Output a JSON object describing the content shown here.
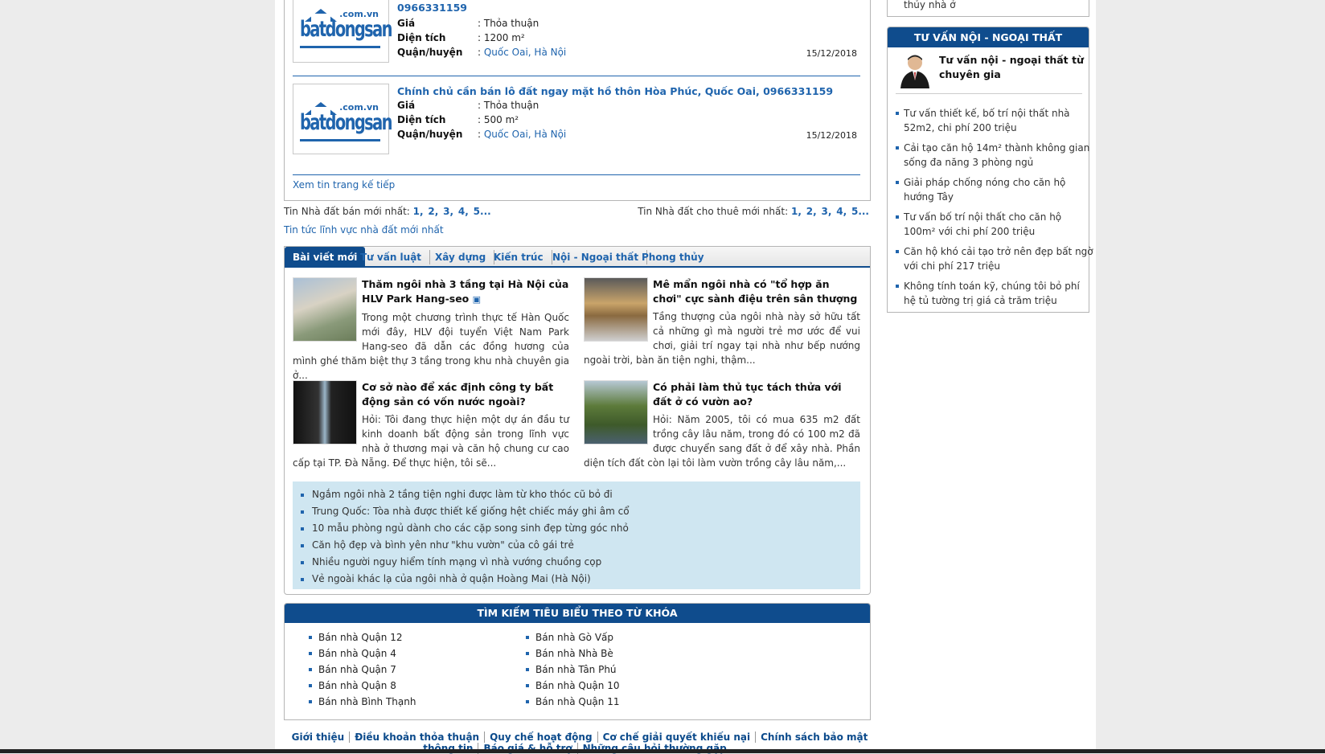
{
  "listings": [
    {
      "title_tail": "0966331159",
      "price_label": "Giá",
      "price": ": Thỏa thuận",
      "area_label": "Diện tích",
      "area": ": 1200 m²",
      "district_label": "Quận/huyện",
      "district_prefix": ": ",
      "district": "Quốc Oai, Hà Nội",
      "date": "15/12/2018"
    },
    {
      "title": "Chính chủ cần bán lô đất ngay mặt hồ thôn Hòa Phúc, Quốc Oai, 0966331159",
      "price_label": "Giá",
      "price": ": Thỏa thuận",
      "area_label": "Diện tích",
      "area": ": 500 m²",
      "district_label": "Quận/huyện",
      "district_prefix": ": ",
      "district": "Quốc Oai, Hà Nội",
      "date": "15/12/2018"
    }
  ],
  "logo": {
    "sub": ".com.vn",
    "main": "batdongsan"
  },
  "next_page_link": "Xem tin trang kế tiếp",
  "latest": {
    "sale_label": "Tin Nhà đất bán mới nhất:",
    "rent_label": "Tin Nhà đất cho thuê mới nhất:",
    "pages": [
      "1,",
      "2,",
      "3,",
      "4,",
      "5..."
    ],
    "news_link": "Tin tức lĩnh vực nhà đất mới nhất"
  },
  "tabs": [
    "Bài viết mới",
    "Tư vấn luật",
    "Xây dựng",
    "Kiến trúc",
    "Nội - Ngoại thất",
    "Phong thủy"
  ],
  "articles": [
    {
      "title": "Thăm ngôi nhà 3 tầng tại Hà Nội của HLV Park Hang-seo",
      "summary": "Trong một chương trình thực tế Hàn Quốc mới đây, HLV đội tuyển Việt Nam Park Hang-seo đã dẫn các đồng hương của mình ghé thăm biệt thự 3 tầng trong khu nhà chuyên gia ở..."
    },
    {
      "title": "Mê mẩn ngôi nhà có \"tổ hợp ăn chơi\" cực sành điệu trên sân thượng",
      "summary": "Tầng thượng của ngôi nhà này sở hữu tất cả những gì mà người trẻ mơ ước để vui chơi, giải trí ngay tại nhà như bếp nướng ngoài trời, bàn ăn tiện nghi, thậm..."
    },
    {
      "title": "Cơ sở nào để xác định công ty bất động sản có vốn nước ngoài?",
      "summary": "Hỏi: Tôi đang thực hiện một dự án đầu tư kinh doanh bất động sản trong lĩnh vực nhà ở thương mại và căn hộ chung cư cao cấp tại TP. Đà Nẵng. Để thực hiện, tôi sẽ..."
    },
    {
      "title": "Có phải làm thủ tục tách thửa với đất ở có vườn ao?",
      "summary": "Hỏi: Năm 2005, tôi có mua 635 m2 đất trồng cây lâu năm, trong đó có 100 m2 đã được chuyển sang đất ở để xây nhà. Phần diện tích đất còn lại tôi làm vườn trồng cây lâu năm,..."
    }
  ],
  "more_articles": [
    "Ngắm ngôi nhà 2 tầng tiện nghi được làm từ kho thóc cũ bỏ đi",
    "Trung Quốc: Tòa nhà được thiết kế giống hệt chiếc máy ghi âm cổ",
    "10 mẫu phòng ngủ dành cho các cặp song sinh đẹp từng góc nhỏ",
    "Căn hộ đẹp và bình yên như \"khu vườn\" của cô gái trẻ",
    "Nhiều người nguy hiểm tính mạng vì nhà vướng chuồng cọp",
    "Vẻ ngoài khác lạ của ngôi nhà ở quận Hoàng Mai (Hà Nội)"
  ],
  "keywords": {
    "title": "TÌM KIẾM TIÊU BIỂU THEO TỪ KHÓA",
    "col1": [
      "Bán nhà Quận 12",
      "Bán nhà Quận 4",
      "Bán nhà Quận 7",
      "Bán nhà Quận 8",
      "Bán nhà Bình Thạnh"
    ],
    "col2": [
      "Bán nhà Gò Vấp",
      "Bán nhà Nhà Bè",
      "Bán nhà Tân Phú",
      "Bán nhà Quận 10",
      "Bán nhà Quận 11"
    ]
  },
  "footer": [
    "Giới thiệu",
    "Điều khoản thỏa thuận",
    "Quy chế hoạt động",
    "Cơ chế giải quyết khiếu nại",
    "Chính sách bảo mật thông tin",
    "Báo giá & hỗ trợ",
    "Những câu hỏi thường gặp"
  ],
  "right": {
    "top_tail": "thủy nhà ở",
    "title": "TƯ VẤN NỘI - NGOẠI THẤT",
    "intro": "Tư vấn nội - ngoại thất từ chuyên gia",
    "items": [
      "Tư vấn thiết kế, bố trí nội thất nhà 52m2, chi phí 200 triệu",
      "Cải tạo căn hộ 14m² thành không gian sống đa năng 3 phòng ngủ",
      "Giải pháp chống nóng cho căn hộ hướng Tây",
      "Tư vấn bố trí nội thất cho căn hộ 100m² với chi phí 200 triệu",
      "Căn hộ khó cải tạo trở nên đẹp bất ngờ với chi phí 217 triệu",
      "Không tính toán kỹ, chúng tôi bỏ phí hệ tủ tường trị giá cả trăm triệu"
    ]
  }
}
